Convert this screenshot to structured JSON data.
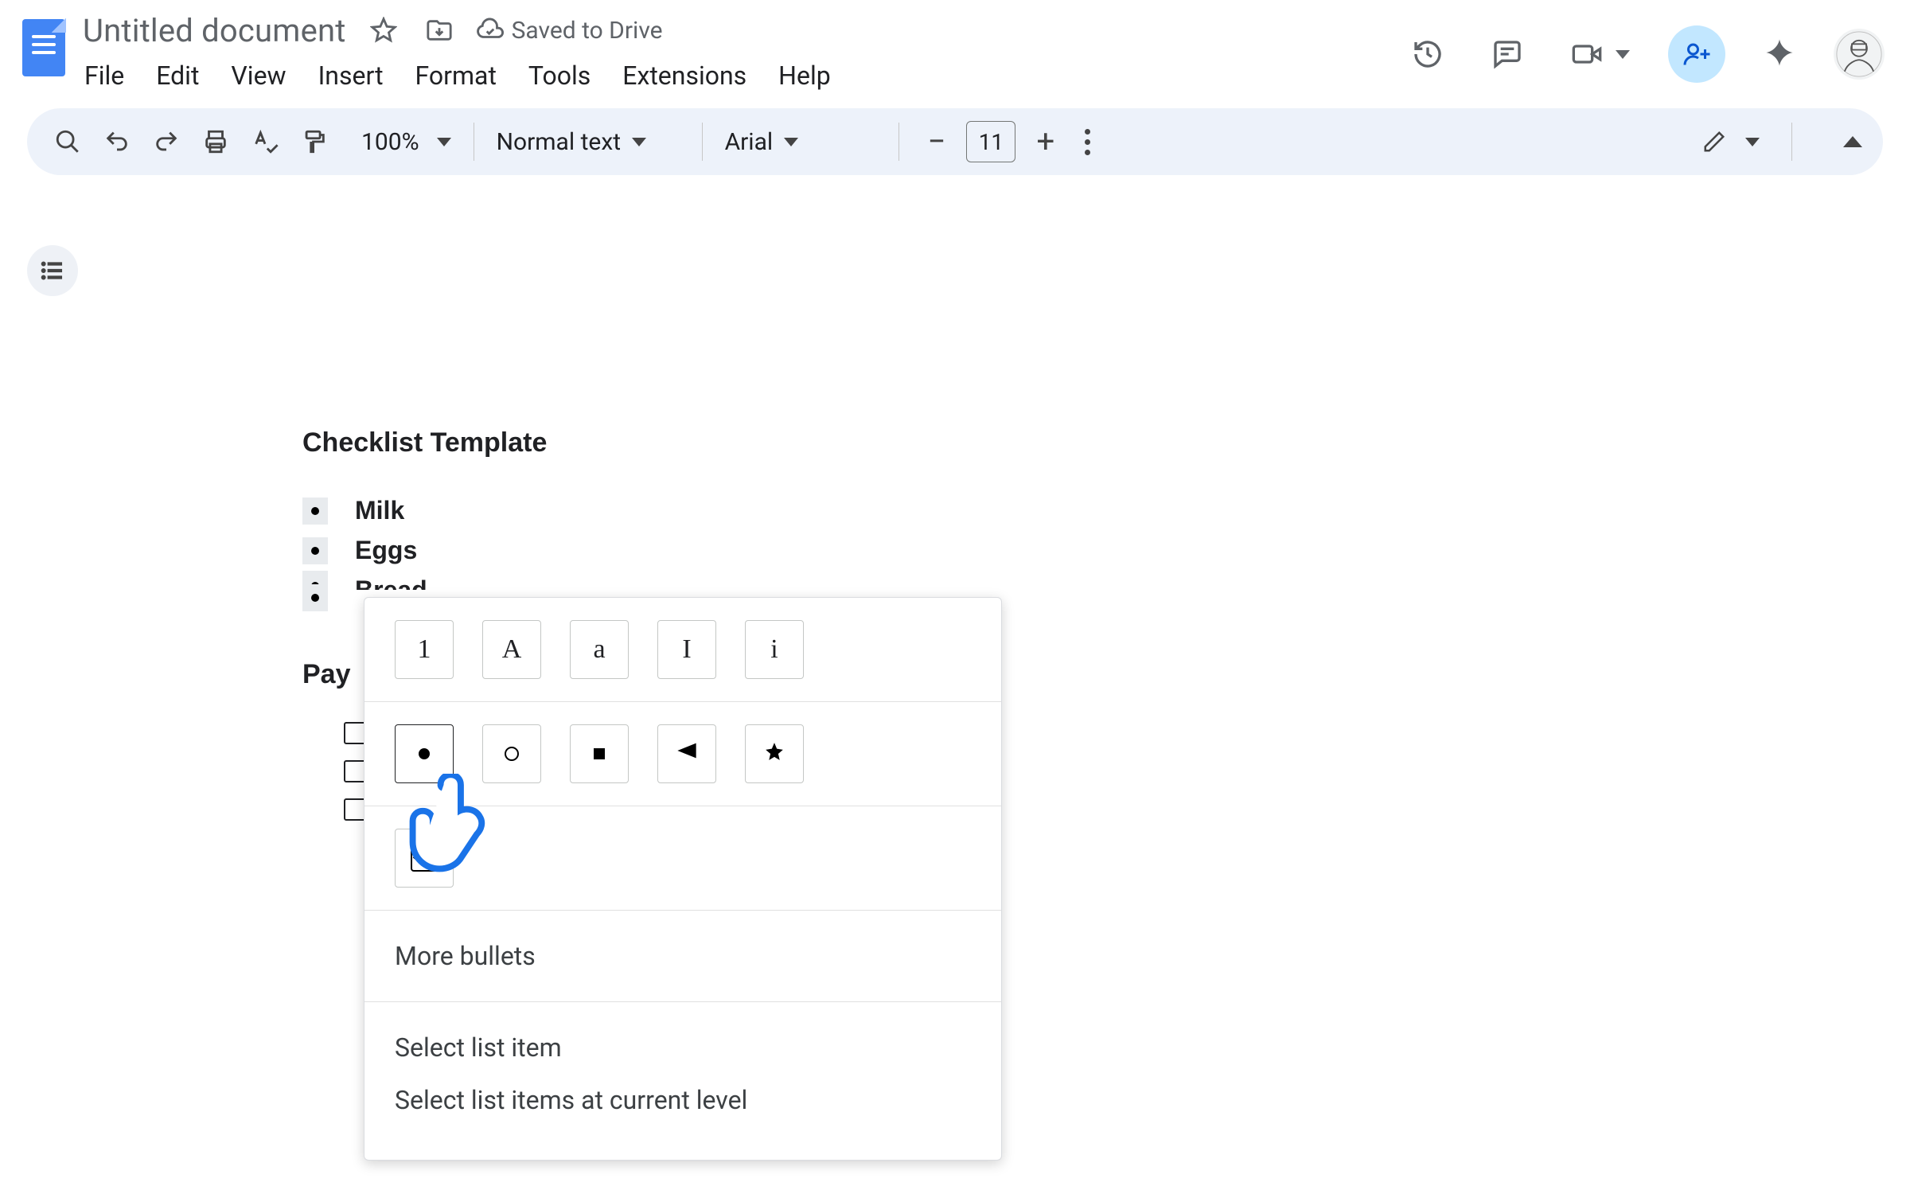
{
  "doc": {
    "title": "Untitled document",
    "save_status": "Saved to Drive"
  },
  "menus": {
    "file": "File",
    "edit": "Edit",
    "view": "View",
    "insert": "Insert",
    "format": "Format",
    "tools": "Tools",
    "extensions": "Extensions",
    "help": "Help"
  },
  "toolbar": {
    "zoom": "100%",
    "style": "Normal text",
    "font": "Arial",
    "font_size": "11"
  },
  "document": {
    "heading1": "Checklist Template",
    "bullets": [
      "Milk",
      "Eggs",
      "Bread",
      ""
    ],
    "heading2": "Pay"
  },
  "context_menu": {
    "numbered_options": [
      "1",
      "A",
      "a",
      "I",
      "i"
    ],
    "bullet_options": [
      "disc",
      "ring",
      "square",
      "arrow",
      "star"
    ],
    "checkbox_option": "checkbox",
    "more_bullets": "More bullets",
    "select_item": "Select list item",
    "select_level": "Select list items at current level"
  }
}
